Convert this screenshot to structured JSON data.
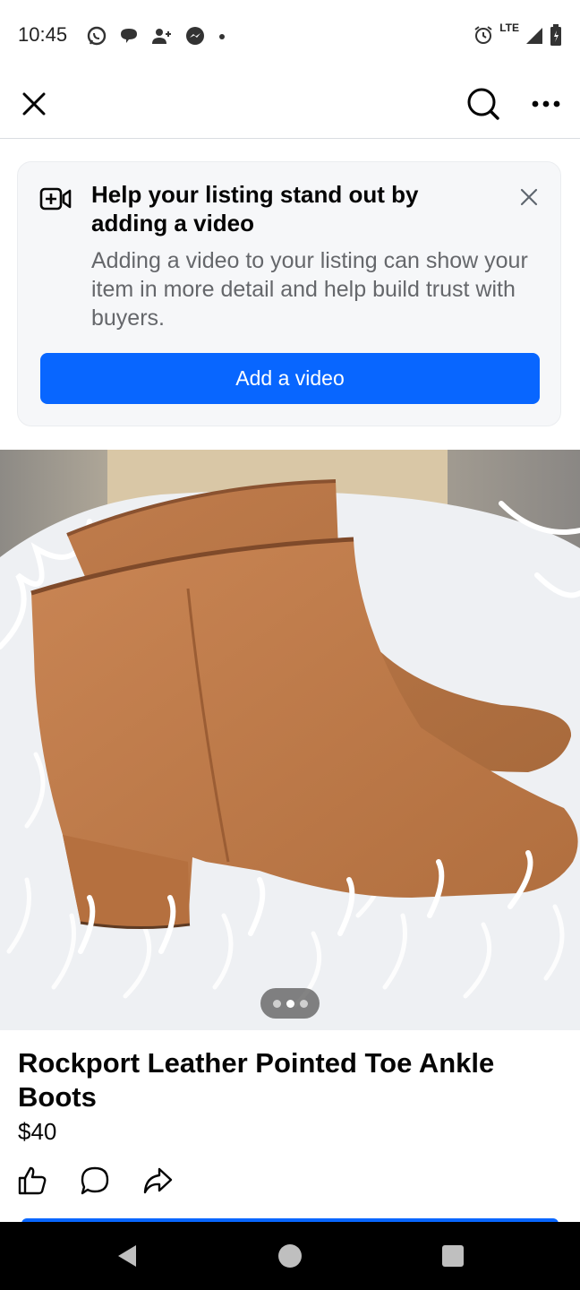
{
  "status_bar": {
    "time": "10:45",
    "network": "LTE",
    "left_icons": [
      "whatsapp-icon",
      "chat-icon",
      "add-person-icon",
      "messenger-icon",
      "dot-icon"
    ],
    "right_icons": [
      "alarm-icon",
      "signal-icon",
      "battery-icon"
    ]
  },
  "top_nav": {
    "icons": [
      "close-icon",
      "search-icon",
      "more-icon"
    ]
  },
  "promo": {
    "title": "Help your listing stand out by adding a video",
    "body": "Adding a video to your listing can show your item in more detail and help build trust with buyers.",
    "cta_label": "Add a video",
    "icons": [
      "add-video-icon",
      "dismiss-icon"
    ]
  },
  "carousel": {
    "dot_count": 3,
    "active_index": 1
  },
  "listing": {
    "title": "Rockport Leather Pointed Toe Ankle Boots",
    "price": "$40",
    "actions": [
      "like-icon",
      "comment-icon",
      "share-icon"
    ]
  },
  "colors": {
    "accent": "#0866ff",
    "text_primary": "#050505",
    "text_secondary": "#65676b",
    "card_bg": "#f6f7f9",
    "boot": "#c07a4a"
  },
  "system_nav": {
    "icons": [
      "back-icon",
      "home-icon",
      "recents-icon"
    ]
  }
}
